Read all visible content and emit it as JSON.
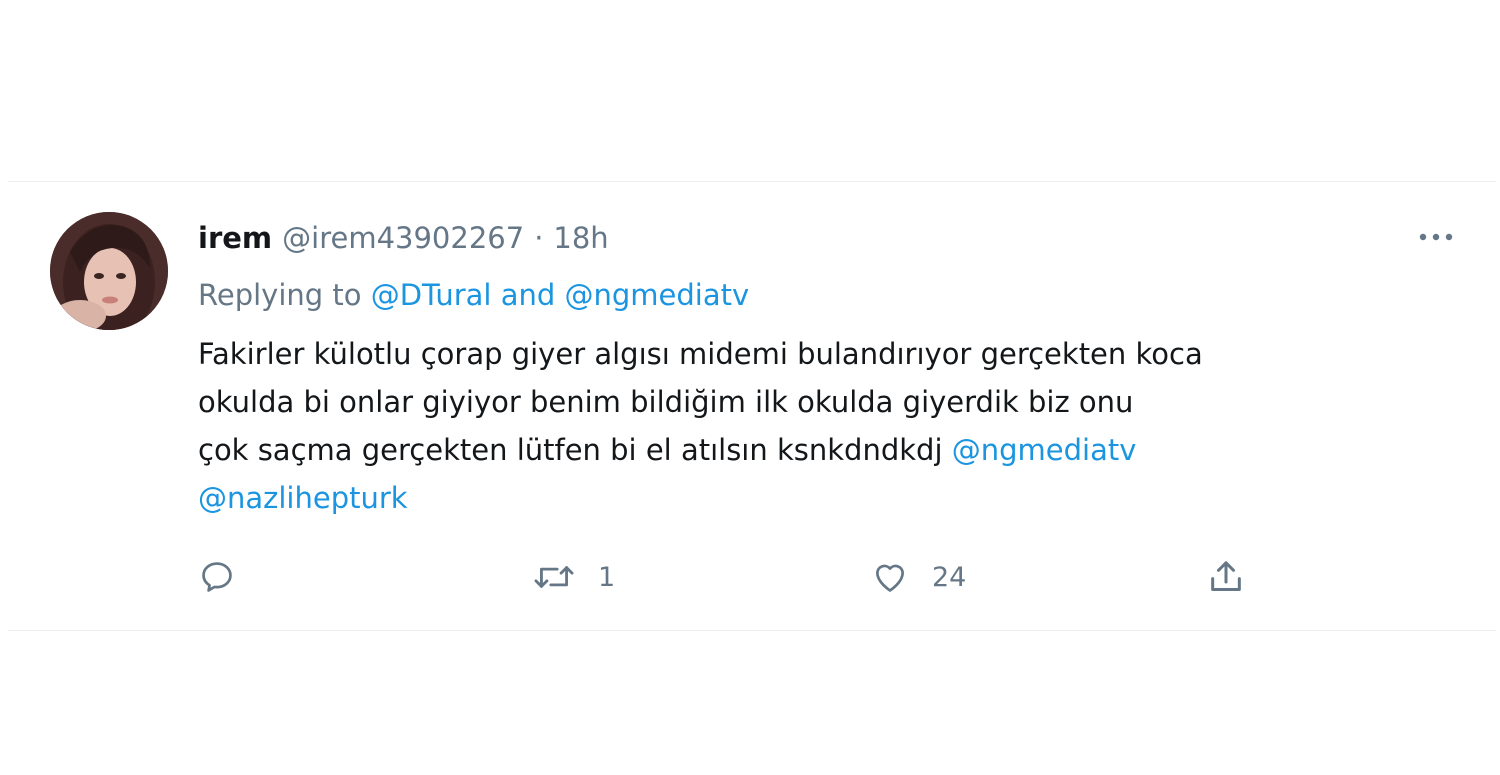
{
  "tweet": {
    "author": {
      "display_name": "irem",
      "handle": "@irem43902267",
      "avatar_icon": "profile-photo"
    },
    "separator": "·",
    "time": "18h",
    "more_icon": "ellipsis-icon",
    "reply_context": {
      "prefix": "Replying to",
      "mention_1": "@DTural",
      "joiner": "and",
      "mention_2": "@ngmediatv"
    },
    "text_lines": [
      "Fakirler külotlu çorap giyer algısı midemi bulandırıyor gerçekten koca",
      "okulda bi onlar giyiyor benim bildiğim ilk okulda giyerdik biz onu",
      "çok saçma gerçekten lütfen bi el atılsın ksnkdndkdj"
    ],
    "text_mentions": [
      "@ngmediatv",
      "@nazlihepturk"
    ],
    "actions": {
      "reply": {
        "icon": "reply-icon",
        "count": ""
      },
      "retweet": {
        "icon": "retweet-icon",
        "count": "1"
      },
      "like": {
        "icon": "heart-icon",
        "count": "24"
      },
      "share": {
        "icon": "share-icon"
      }
    }
  },
  "colors": {
    "text_primary": "#14171a",
    "text_secondary": "#657786",
    "link": "#1b95e0",
    "background": "#ffffff"
  }
}
